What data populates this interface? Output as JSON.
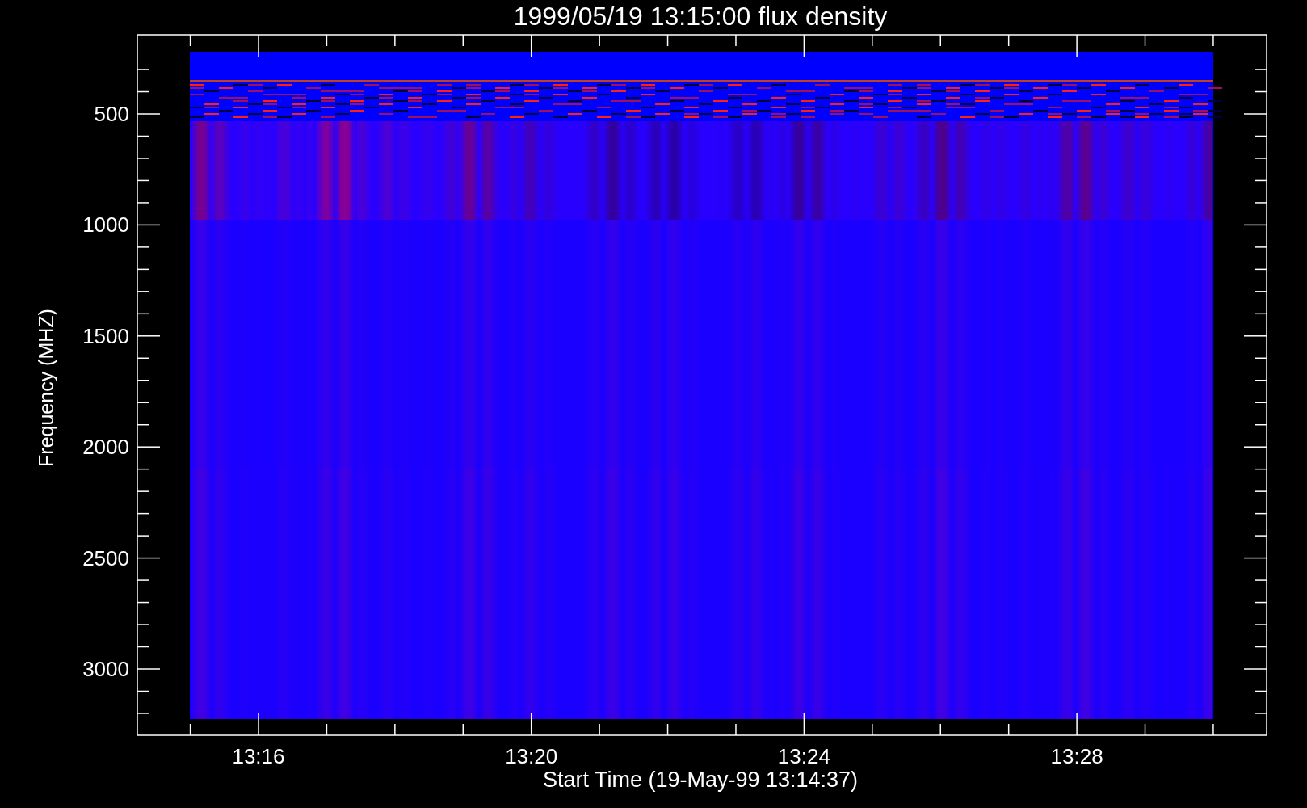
{
  "title": "1999/05/19 13:15:00 flux density",
  "ylabel": "Frequency (MHZ)",
  "xlabel": "Start Time (19-May-99 13:14:37)",
  "yticks": [
    "500",
    "1000",
    "1500",
    "2000",
    "2500",
    "3000"
  ],
  "xticks": [
    "13:16",
    "13:20",
    "13:24",
    "13:28"
  ]
}
